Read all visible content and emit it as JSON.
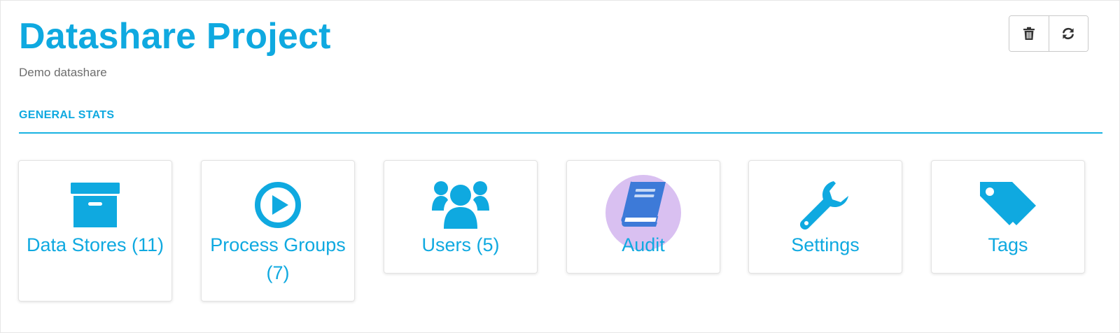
{
  "header": {
    "title": "Datashare Project",
    "subtitle": "Demo datashare"
  },
  "toolbar": {
    "delete_icon": "trash-icon",
    "refresh_icon": "refresh-icon"
  },
  "section": {
    "title": "GENERAL STATS"
  },
  "cards": [
    {
      "label": "Data Stores (11)",
      "icon": "archive-box-icon"
    },
    {
      "label": "Process Groups (7)",
      "icon": "play-circle-icon"
    },
    {
      "label": "Users (5)",
      "icon": "users-icon"
    },
    {
      "label": "Audit",
      "icon": "book-icon"
    },
    {
      "label": "Settings",
      "icon": "wrench-icon"
    },
    {
      "label": "Tags",
      "icon": "tags-icon"
    }
  ],
  "colors": {
    "accent": "#0fa9e0",
    "muted_text": "#6d6d6d",
    "audit_icon": "#3d7ad8",
    "highlight": "#ba8ce6"
  }
}
